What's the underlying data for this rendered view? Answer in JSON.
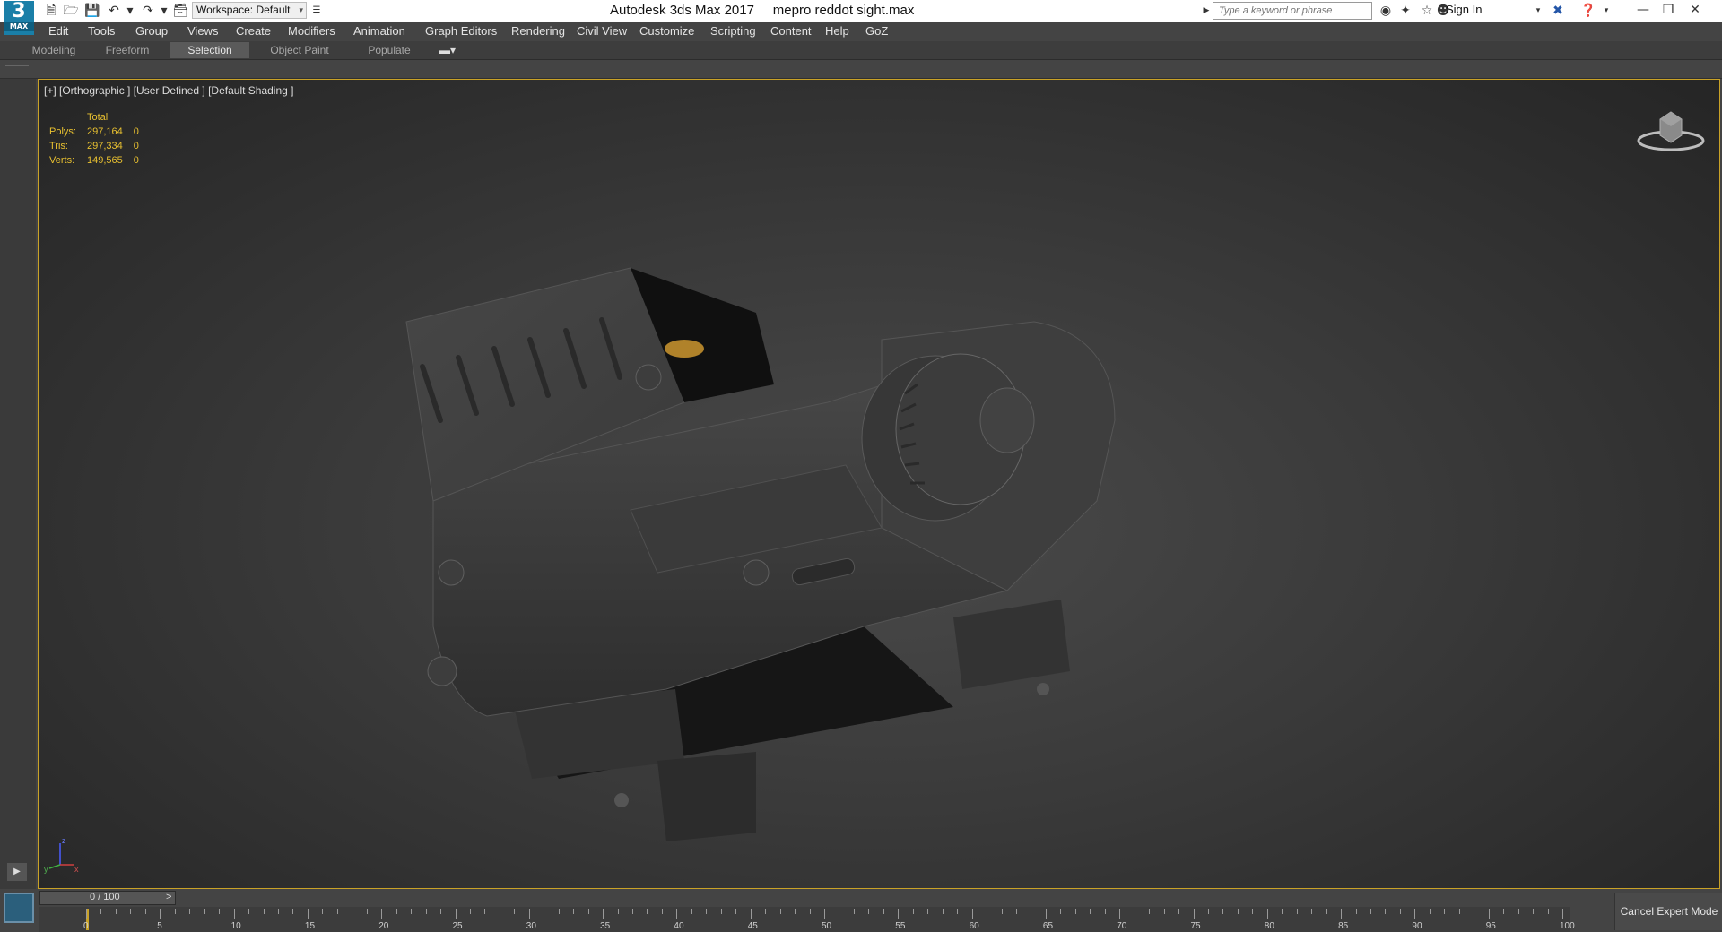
{
  "app": {
    "logo_text": "3",
    "logo_sub": "MAX",
    "title": "Autodesk 3ds Max 2017     mepro reddot sight.max"
  },
  "toolbar": {
    "workspace_label": "Workspace: Default",
    "search_placeholder": "Type a keyword or phrase",
    "sign_in": "Sign In"
  },
  "menu": [
    "Edit",
    "Tools",
    "Group",
    "Views",
    "Create",
    "Modifiers",
    "Animation",
    "Graph Editors",
    "Rendering",
    "Civil View",
    "Customize",
    "Scripting",
    "Content",
    "Help",
    "GoZ"
  ],
  "ribbon_tabs": [
    {
      "label": "Modeling",
      "active": false
    },
    {
      "label": "Freeform",
      "active": false
    },
    {
      "label": "Selection",
      "active": true
    },
    {
      "label": "Object Paint",
      "active": false
    },
    {
      "label": "Populate",
      "active": false
    }
  ],
  "viewport": {
    "label": "[+] [Orthographic ] [User Defined ] [Default Shading ]",
    "stats": {
      "header": "Total",
      "rows": [
        {
          "name": "Polys:",
          "total": "297,164",
          "sel": "0"
        },
        {
          "name": "Tris:",
          "total": "297,334",
          "sel": "0"
        },
        {
          "name": "Verts:",
          "total": "149,565",
          "sel": "0"
        }
      ]
    },
    "axis": {
      "z": "z",
      "x": "x",
      "y": "y"
    }
  },
  "timeline": {
    "frame_display": "0 / 100",
    "prev": "<",
    "next": ">",
    "ticks": [
      "0",
      "5",
      "10",
      "15",
      "20",
      "25",
      "30",
      "35",
      "40",
      "45",
      "50",
      "55",
      "60",
      "65",
      "70",
      "75",
      "80",
      "85",
      "90",
      "95",
      "100"
    ],
    "cancel_expert": "Cancel Expert Mode"
  },
  "colors": {
    "accent": "#c9a227",
    "stats": "#e8c030",
    "brand": "#1a7fa8"
  }
}
